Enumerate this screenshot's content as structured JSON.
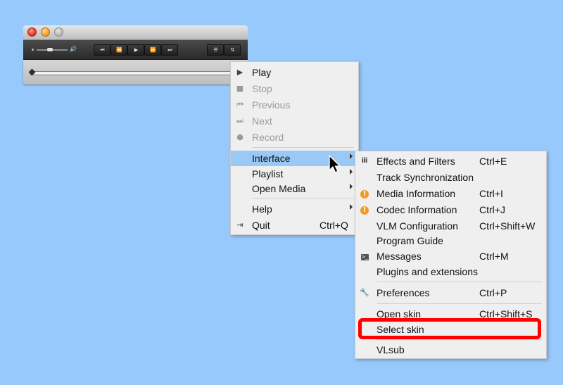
{
  "player": {
    "volume_max_glyph": "🔊",
    "buttons": [
      "⏮",
      "⏪",
      "▶",
      "⏩",
      "⏭"
    ],
    "view_buttons": [
      "☰",
      "⇅"
    ]
  },
  "main_menu": {
    "items": [
      {
        "label": "Play",
        "icon": "play-icon",
        "glyph": "▶",
        "enabled": true
      },
      {
        "label": "Stop",
        "icon": "stop-icon",
        "glyph": "■",
        "enabled": false
      },
      {
        "label": "Previous",
        "icon": "previous-icon",
        "glyph": "⏮",
        "enabled": false
      },
      {
        "label": "Next",
        "icon": "next-icon",
        "glyph": "⏭",
        "enabled": false
      },
      {
        "label": "Record",
        "icon": "record-icon",
        "glyph": "●",
        "enabled": false
      },
      {
        "label": "Interface",
        "submenu": true,
        "highlighted": true
      },
      {
        "label": "Playlist",
        "submenu": true
      },
      {
        "label": "Open Media",
        "submenu": true
      },
      {
        "label": "Help",
        "submenu": true
      },
      {
        "label": "Quit",
        "icon": "quit-icon",
        "glyph": "⇥",
        "shortcut": "Ctrl+Q"
      }
    ]
  },
  "interface_menu": {
    "items": [
      {
        "label": "Effects and Filters",
        "shortcut": "Ctrl+E",
        "icon": "equalizer-icon"
      },
      {
        "label": "Track Synchronization"
      },
      {
        "label": "Media Information",
        "shortcut": "Ctrl+I",
        "icon": "info-icon"
      },
      {
        "label": "Codec Information",
        "shortcut": "Ctrl+J",
        "icon": "info-icon"
      },
      {
        "label": "VLM Configuration",
        "shortcut": "Ctrl+Shift+W"
      },
      {
        "label": "Program Guide"
      },
      {
        "label": "Messages",
        "shortcut": "Ctrl+M",
        "icon": "terminal-icon"
      },
      {
        "label": "Plugins and extensions"
      },
      {
        "label": "Preferences",
        "shortcut": "Ctrl+P",
        "icon": "wrench-icon"
      },
      {
        "label": "Open skin",
        "shortcut": "Ctrl+Shift+S"
      },
      {
        "label": "Select skin",
        "submenu": true
      },
      {
        "label": "VLsub"
      }
    ]
  },
  "colors": {
    "background": "#97c9fd",
    "highlight": "#9ac9f5",
    "annotation": "#ff0000",
    "info_icon": "#f39a1d"
  }
}
